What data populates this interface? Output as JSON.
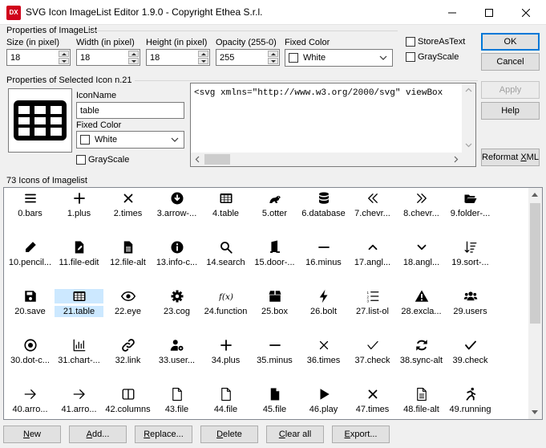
{
  "window": {
    "title": "SVG Icon ImageList Editor 1.9.0 - Copyright Ethea S.r.l.",
    "app_icon_text": "DX"
  },
  "imagelist_props": {
    "legend": "Properties of ImageList",
    "size_label": "Size (in pixel)",
    "size_value": "18",
    "width_label": "Width (in pixel)",
    "width_value": "18",
    "height_label": "Height (in pixel)",
    "height_value": "18",
    "opacity_label": "Opacity (255-0)",
    "opacity_value": "255",
    "fixed_color_label": "Fixed Color",
    "fixed_color_value": "White",
    "store_as_text_label": "StoreAsText",
    "grayscale_label": "GrayScale"
  },
  "icon_props": {
    "legend": "Properties of Selected Icon n.21",
    "iconname_label": "IconName",
    "iconname_value": "table",
    "fixed_color_label": "Fixed Color",
    "fixed_color_value": "White",
    "grayscale_label": "GrayScale",
    "svg_text": "<svg xmlns=\"http://www.w3.org/2000/svg\" viewBox"
  },
  "buttons": {
    "ok": "OK",
    "cancel": "Cancel",
    "apply": "Apply",
    "help": "Help",
    "reformat_pre": "Reformat ",
    "reformat_u": "X",
    "reformat_post": "ML"
  },
  "iconlist": {
    "legend": "73 Icons of Imagelist",
    "items": [
      {
        "label": "0.bars",
        "icon": "bars-icon"
      },
      {
        "label": "1.plus",
        "icon": "plus-icon"
      },
      {
        "label": "2.times",
        "icon": "times-icon"
      },
      {
        "label": "3.arrow-...",
        "icon": "arrow-circle-down-icon"
      },
      {
        "label": "4.table",
        "icon": "table-icon"
      },
      {
        "label": "5.otter",
        "icon": "otter-icon"
      },
      {
        "label": "6.database",
        "icon": "database-icon"
      },
      {
        "label": "7.chevr...",
        "icon": "chevrons-left-icon"
      },
      {
        "label": "8.chevr...",
        "icon": "chevrons-right-icon"
      },
      {
        "label": "9.folder-...",
        "icon": "folder-open-icon"
      },
      {
        "label": "10.pencil...",
        "icon": "pencil-icon"
      },
      {
        "label": "11.file-edit",
        "icon": "file-edit-icon"
      },
      {
        "label": "12.file-alt",
        "icon": "file-alt-icon"
      },
      {
        "label": "13.info-c...",
        "icon": "info-circle-icon"
      },
      {
        "label": "14.search",
        "icon": "search-icon"
      },
      {
        "label": "15.door-...",
        "icon": "door-open-icon"
      },
      {
        "label": "16.minus",
        "icon": "minus-icon"
      },
      {
        "label": "17.angl...",
        "icon": "angle-up-icon"
      },
      {
        "label": "18.angl...",
        "icon": "angle-down-icon"
      },
      {
        "label": "19.sort-...",
        "icon": "sort-icon"
      },
      {
        "label": "20.save",
        "icon": "save-icon"
      },
      {
        "label": "21.table",
        "icon": "table-icon"
      },
      {
        "label": "22.eye",
        "icon": "eye-icon"
      },
      {
        "label": "23.cog",
        "icon": "cog-icon"
      },
      {
        "label": "24.function",
        "icon": "function-icon"
      },
      {
        "label": "25.box",
        "icon": "box-icon"
      },
      {
        "label": "26.bolt",
        "icon": "bolt-icon"
      },
      {
        "label": "27.list-ol",
        "icon": "list-ol-icon"
      },
      {
        "label": "28.excla...",
        "icon": "exclamation-triangle-icon"
      },
      {
        "label": "29.users",
        "icon": "users-icon"
      },
      {
        "label": "30.dot-c...",
        "icon": "dot-circle-icon"
      },
      {
        "label": "31.chart-...",
        "icon": "chart-bar-icon"
      },
      {
        "label": "32.link",
        "icon": "link-icon"
      },
      {
        "label": "33.user...",
        "icon": "user-cog-icon"
      },
      {
        "label": "34.plus",
        "icon": "plus-icon"
      },
      {
        "label": "35.minus",
        "icon": "minus-icon"
      },
      {
        "label": "36.times",
        "icon": "times-thin-icon"
      },
      {
        "label": "37.check",
        "icon": "check-thin-icon"
      },
      {
        "label": "38.sync-alt",
        "icon": "sync-alt-icon"
      },
      {
        "label": "39.check",
        "icon": "check-icon"
      },
      {
        "label": "40.arro...",
        "icon": "arrow-right-icon"
      },
      {
        "label": "41.arro...",
        "icon": "arrow-right-icon"
      },
      {
        "label": "42.columns",
        "icon": "columns-icon"
      },
      {
        "label": "43.file",
        "icon": "file-outline-icon"
      },
      {
        "label": "44.file",
        "icon": "file-outline-icon"
      },
      {
        "label": "45.file",
        "icon": "file-icon"
      },
      {
        "label": "46.play",
        "icon": "play-icon"
      },
      {
        "label": "47.times",
        "icon": "times-icon"
      },
      {
        "label": "48.file-alt",
        "icon": "file-alt-outline-icon"
      },
      {
        "label": "49.running",
        "icon": "running-icon"
      }
    ],
    "selected_index": 21,
    "selection_color": "#cce8ff"
  },
  "bottom_buttons": [
    {
      "pre": "",
      "u": "N",
      "post": "ew",
      "name": "new-button"
    },
    {
      "pre": "",
      "u": "A",
      "post": "dd...",
      "name": "add-button"
    },
    {
      "pre": "",
      "u": "R",
      "post": "eplace...",
      "name": "replace-button"
    },
    {
      "pre": "",
      "u": "D",
      "post": "elete",
      "name": "delete-button"
    },
    {
      "pre": "",
      "u": "C",
      "post": "lear all",
      "name": "clear-all-button"
    },
    {
      "pre": "",
      "u": "E",
      "post": "xport...",
      "name": "export-button"
    }
  ]
}
